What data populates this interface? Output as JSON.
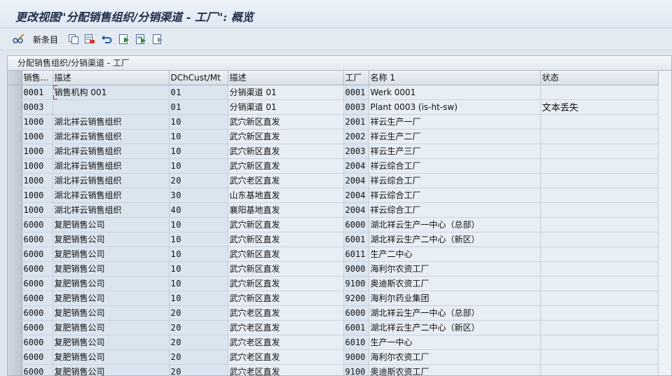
{
  "window": {
    "title": "更改视图\"分配销售组织/分销渠道 - 工厂\": 概览"
  },
  "toolbar": {
    "new_entries_label": "新条目"
  },
  "table": {
    "title": "分配销售组织/分销渠道 - 工厂",
    "columns": [
      "销售...",
      "描述",
      "DChCust/Mt",
      "描述",
      "工厂",
      "名称 1",
      "状态"
    ],
    "rows": [
      [
        "0001",
        "销售机构 001",
        "01",
        "分销渠道 01",
        "0001",
        "Werk 0001",
        ""
      ],
      [
        "0003",
        "",
        "01",
        "分销渠道 01",
        "0003",
        "Plant 0003 (is-ht-sw)",
        "文本丢失"
      ],
      [
        "1000",
        "湖北祥云销售组织",
        "10",
        "武穴新区直发",
        "2001",
        "祥云生产一厂",
        ""
      ],
      [
        "1000",
        "湖北祥云销售组织",
        "10",
        "武穴新区直发",
        "2002",
        "祥云生产二厂",
        ""
      ],
      [
        "1000",
        "湖北祥云销售组织",
        "10",
        "武穴新区直发",
        "2003",
        "祥云生产三厂",
        ""
      ],
      [
        "1000",
        "湖北祥云销售组织",
        "10",
        "武穴新区直发",
        "2004",
        "祥云综合工厂",
        ""
      ],
      [
        "1000",
        "湖北祥云销售组织",
        "20",
        "武穴老区直发",
        "2004",
        "祥云综合工厂",
        ""
      ],
      [
        "1000",
        "湖北祥云销售组织",
        "30",
        "山东基地直发",
        "2004",
        "祥云综合工厂",
        ""
      ],
      [
        "1000",
        "湖北祥云销售组织",
        "40",
        "襄阳基地直发",
        "2004",
        "祥云综合工厂",
        ""
      ],
      [
        "6000",
        "复肥销售公司",
        "10",
        "武穴新区直发",
        "6000",
        "湖北祥云生产一中心（总部）",
        ""
      ],
      [
        "6000",
        "复肥销售公司",
        "10",
        "武穴新区直发",
        "6001",
        "湖北祥云生产二中心（新区）",
        ""
      ],
      [
        "6000",
        "复肥销售公司",
        "10",
        "武穴新区直发",
        "6011",
        "生产二中心",
        ""
      ],
      [
        "6000",
        "复肥销售公司",
        "10",
        "武穴新区直发",
        "9000",
        "海利尔农资工厂",
        ""
      ],
      [
        "6000",
        "复肥销售公司",
        "10",
        "武穴新区直发",
        "9100",
        "奥迪斯农资工厂",
        ""
      ],
      [
        "6000",
        "复肥销售公司",
        "10",
        "武穴新区直发",
        "9200",
        "海利尔药业集团",
        ""
      ],
      [
        "6000",
        "复肥销售公司",
        "20",
        "武穴老区直发",
        "6000",
        "湖北祥云生产一中心（总部）",
        ""
      ],
      [
        "6000",
        "复肥销售公司",
        "20",
        "武穴老区直发",
        "6001",
        "湖北祥云生产二中心（新区）",
        ""
      ],
      [
        "6000",
        "复肥销售公司",
        "20",
        "武穴老区直发",
        "6010",
        "生产一中心",
        ""
      ],
      [
        "6000",
        "复肥销售公司",
        "20",
        "武穴老区直发",
        "9000",
        "海利尔农资工厂",
        ""
      ],
      [
        "6000",
        "复肥销售公司",
        "20",
        "武穴老区直发",
        "9100",
        "奥迪斯农资工厂",
        ""
      ]
    ]
  }
}
